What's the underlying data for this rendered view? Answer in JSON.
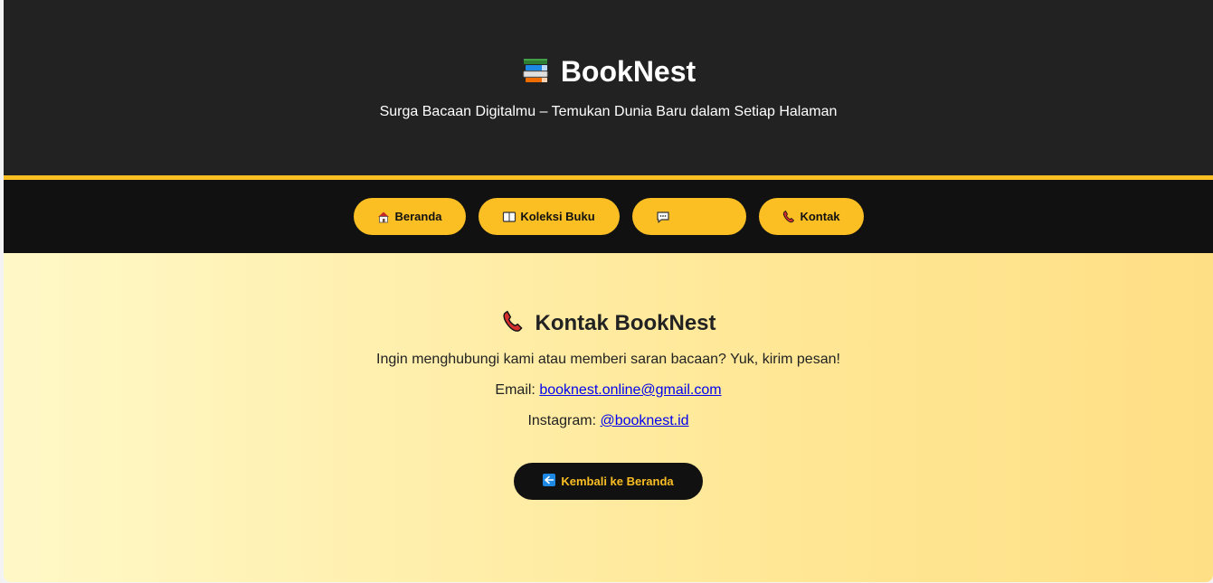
{
  "header": {
    "title": "BookNest",
    "logo_icon": "books-icon",
    "tagline": "Surga Bacaan Digitalmu – Temukan Dunia Baru dalam Setiap Halaman"
  },
  "nav": {
    "items": [
      {
        "label": "Beranda",
        "icon": "house-icon"
      },
      {
        "label": "Koleksi Buku",
        "icon": "book-icon"
      },
      {
        "label": "",
        "icon": "speech-bubble-icon"
      },
      {
        "label": "Kontak",
        "icon": "phone-icon"
      }
    ]
  },
  "contact": {
    "title": "Kontak BookNest",
    "icon": "phone-icon",
    "intro": "Ingin menghubungi kami atau memberi saran bacaan? Yuk, kirim pesan!",
    "email_label": "Email: ",
    "email_value": "booknest.online@gmail.com",
    "instagram_label": "Instagram: ",
    "instagram_value": "@booknest.id",
    "back_button": "Kembali ke Beranda",
    "back_icon": "left-arrow-icon"
  },
  "colors": {
    "header_bg": "#222222",
    "nav_bg": "#111111",
    "accent": "#fbbf24",
    "gradient_start": "#fff8c7",
    "gradient_end": "#ffdf85"
  }
}
